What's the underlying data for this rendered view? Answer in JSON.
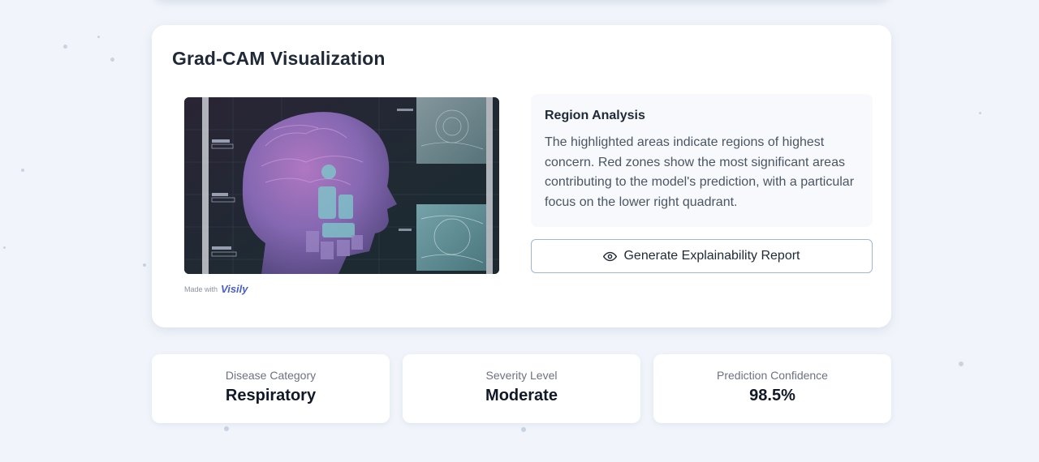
{
  "gradcam": {
    "title": "Grad-CAM Visualization",
    "watermark": {
      "prefix": "Made with",
      "brand": "Visily"
    },
    "region_analysis": {
      "title": "Region Analysis",
      "text": "The highlighted areas indicate regions of highest concern. Red zones show the most significant areas contributing to the model's prediction, with a particular focus on the lower right quadrant."
    },
    "report_button": {
      "label": "Generate Explainability Report",
      "icon": "eye-icon"
    }
  },
  "stats": [
    {
      "label": "Disease Category",
      "value": "Respiratory"
    },
    {
      "label": "Severity Level",
      "value": "Moderate"
    },
    {
      "label": "Prediction Confidence",
      "value": "98.5%"
    }
  ],
  "colors": {
    "page_bg": "#f1f5fb",
    "card_bg": "#ffffff",
    "button_border": "#9fb6d6",
    "brand": "#4b5fc9"
  }
}
